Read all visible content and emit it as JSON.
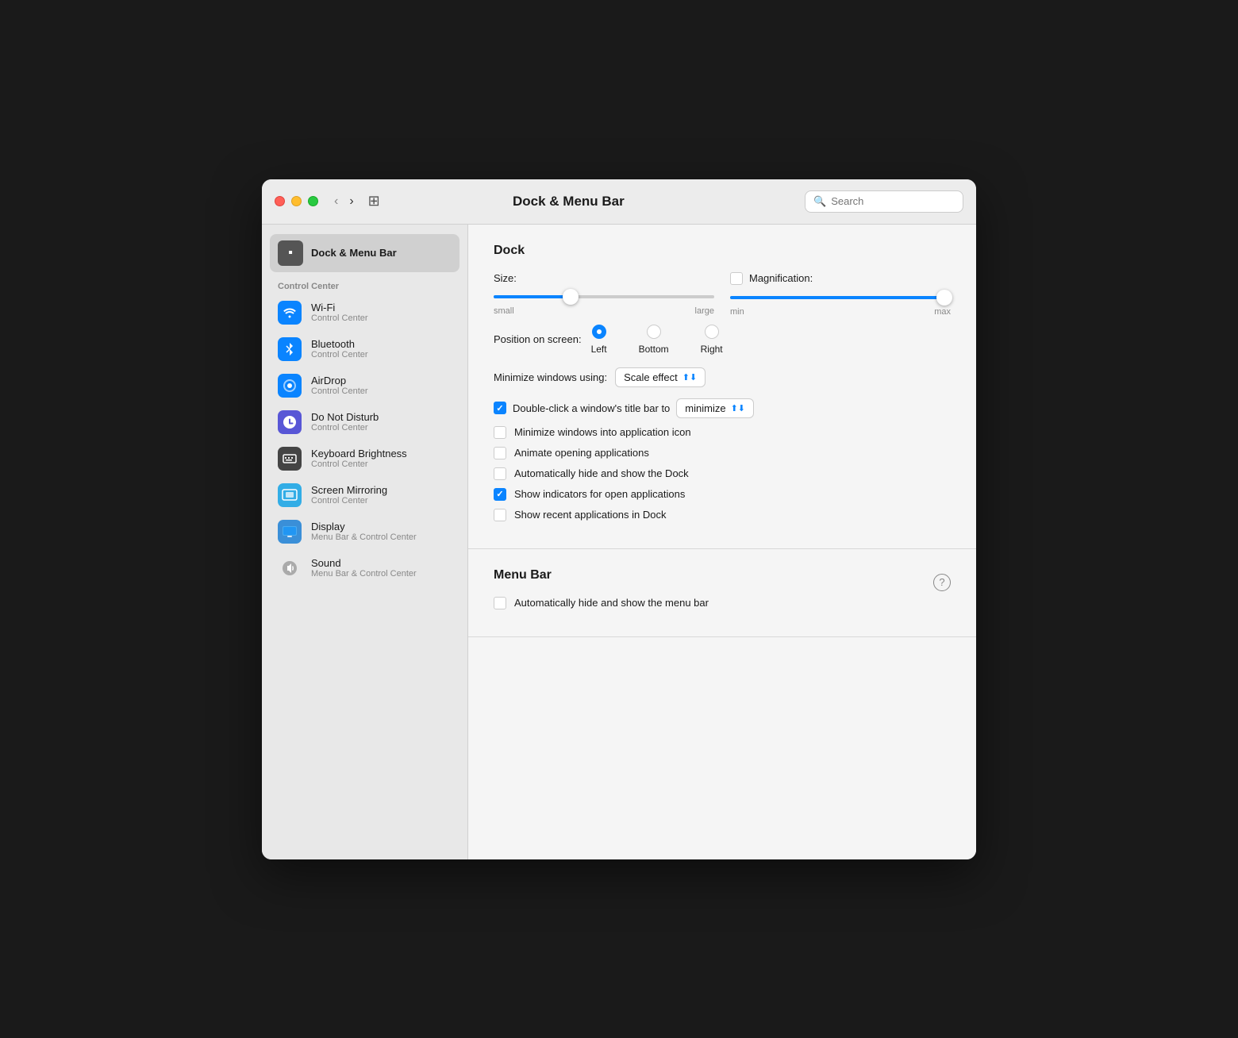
{
  "window": {
    "title": "Dock & Menu Bar"
  },
  "titlebar": {
    "back_btn": "‹",
    "forward_btn": "›",
    "grid_btn": "⊞",
    "search_placeholder": "Search"
  },
  "sidebar": {
    "selected_item": {
      "label": "Dock & Menu Bar",
      "icon": "🖥"
    },
    "section_label": "Control Center",
    "items": [
      {
        "name": "Wi-Fi",
        "sub": "Control Center",
        "icon": "wifi",
        "icon_class": "icon-blue2"
      },
      {
        "name": "Bluetooth",
        "sub": "Control Center",
        "icon": "bluetooth",
        "icon_class": "icon-blue2"
      },
      {
        "name": "AirDrop",
        "sub": "Control Center",
        "icon": "airdrop",
        "icon_class": "icon-blue2"
      },
      {
        "name": "Do Not Disturb",
        "sub": "Control Center",
        "icon": "dnd",
        "icon_class": "icon-purple"
      },
      {
        "name": "Keyboard Brightness",
        "sub": "Control Center",
        "icon": "keyboard",
        "icon_class": "icon-dark"
      },
      {
        "name": "Screen Mirroring",
        "sub": "Control Center",
        "icon": "mirror",
        "icon_class": "icon-cyan"
      },
      {
        "name": "Display",
        "sub": "Menu Bar & Control Center",
        "icon": "display",
        "icon_class": "icon-teal"
      },
      {
        "name": "Sound",
        "sub": "Menu Bar & Control Center",
        "icon": "sound",
        "icon_class": "icon-transparent"
      }
    ]
  },
  "dock_section": {
    "title": "Dock",
    "size_label": "Size:",
    "size_small": "small",
    "size_large": "large",
    "size_fill_pct": 35,
    "size_thumb_pct": 35,
    "magnification_label": "Magnification:",
    "mag_fill_pct": 98,
    "mag_thumb_pct": 98,
    "mag_min": "min",
    "mag_max": "max",
    "position_label": "Position on screen:",
    "position_options": [
      {
        "label": "Left",
        "selected": true
      },
      {
        "label": "Bottom",
        "selected": false
      },
      {
        "label": "Right",
        "selected": false
      }
    ],
    "minimize_label": "Minimize windows using:",
    "minimize_value": "Scale effect",
    "double_click_label": "Double-click a window's title bar to",
    "double_click_value": "minimize",
    "checkboxes": [
      {
        "label": "Minimize windows into application icon",
        "checked": false
      },
      {
        "label": "Animate opening applications",
        "checked": false
      },
      {
        "label": "Automatically hide and show the Dock",
        "checked": false
      },
      {
        "label": "Show indicators for open applications",
        "checked": true
      },
      {
        "label": "Show recent applications in Dock",
        "checked": false
      }
    ]
  },
  "menubar_section": {
    "title": "Menu Bar",
    "checkboxes": [
      {
        "label": "Automatically hide and show the menu bar",
        "checked": false
      }
    ]
  },
  "icons": {
    "wifi": "📶",
    "bluetooth": "Ⓑ",
    "airdrop": "📡",
    "dnd": "🌙",
    "keyboard": "⌨",
    "mirror": "📺",
    "display": "🖥",
    "sound": "🔊"
  }
}
